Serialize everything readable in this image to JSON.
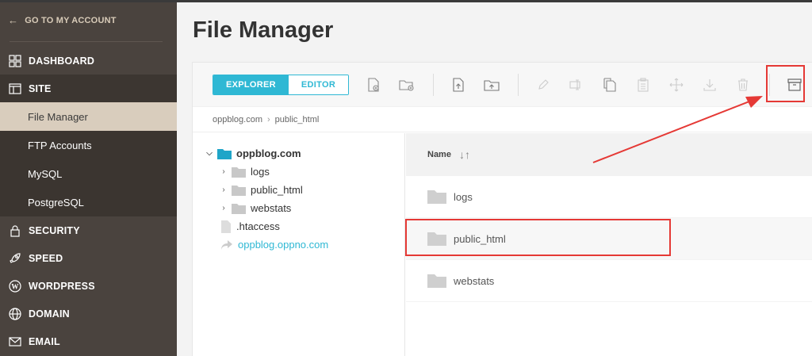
{
  "sidebar": {
    "back_label": "GO TO MY ACCOUNT",
    "items": [
      {
        "label": "DASHBOARD",
        "icon": "dashboard-icon"
      },
      {
        "label": "SITE",
        "icon": "site-icon"
      }
    ],
    "site_sub": [
      "File Manager",
      "FTP Accounts",
      "MySQL",
      "PostgreSQL"
    ],
    "items_after": [
      {
        "label": "SECURITY",
        "icon": "lock-icon"
      },
      {
        "label": "SPEED",
        "icon": "rocket-icon"
      },
      {
        "label": "WORDPRESS",
        "icon": "wordpress-icon"
      },
      {
        "label": "DOMAIN",
        "icon": "globe-icon"
      },
      {
        "label": "EMAIL",
        "icon": "mail-icon"
      }
    ]
  },
  "main": {
    "title": "File Manager",
    "tabs": {
      "explorer": "EXPLORER",
      "editor": "EDITOR"
    },
    "breadcrumb": [
      "oppblog.com",
      "public_html"
    ],
    "tree": {
      "root": "oppblog.com",
      "children": [
        "logs",
        "public_html",
        "webstats"
      ],
      "files": [
        ".htaccess"
      ],
      "links": [
        "oppblog.oppno.com"
      ]
    },
    "list": {
      "header": "Name",
      "rows": [
        "logs",
        "public_html",
        "webstats"
      ]
    }
  },
  "colors": {
    "accent": "#2fb8d4",
    "sidebar": "#4a433e",
    "annotation": "#e53935"
  }
}
